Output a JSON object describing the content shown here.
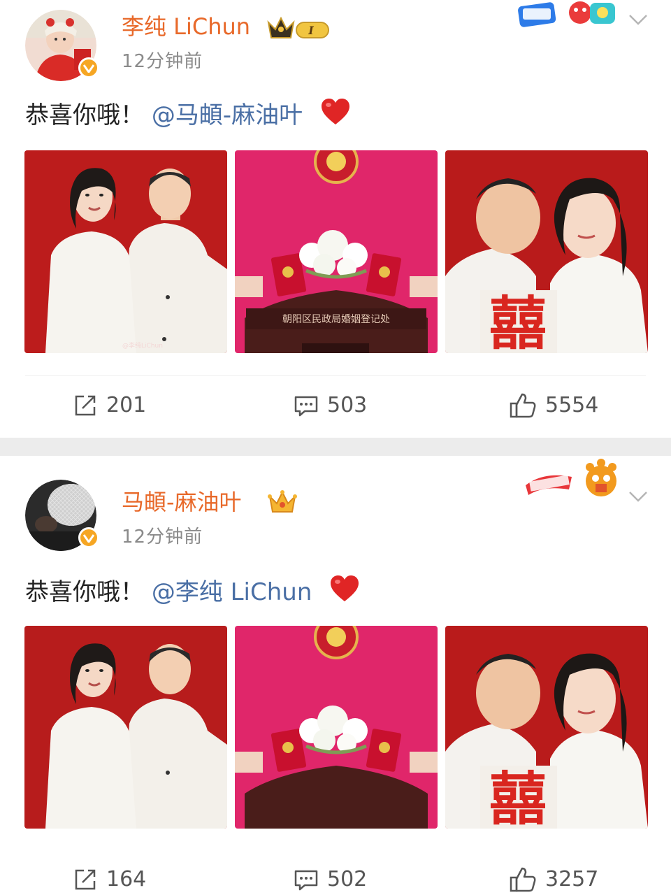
{
  "posts": [
    {
      "user": "李纯 LiChun",
      "time": "12分钟前",
      "text_prefix": "恭喜你哦！",
      "mention": "@马頔-麻油叶",
      "crown_badge": "I",
      "watermark": "@李纯LiChun",
      "plaque": "朝阳区民政局婚姻登记处",
      "stats": {
        "repost": "201",
        "comment": "503",
        "like": "5554"
      }
    },
    {
      "user": "马頔-麻油叶",
      "time": "12分钟前",
      "text_prefix": "恭喜你哦！",
      "mention": "@李纯 LiChun",
      "stats": {
        "repost": "164",
        "comment": "502",
        "like": "3257"
      }
    }
  ],
  "icons": {
    "repost": "repost-icon",
    "comment": "comment-icon",
    "like": "thumbs-up-icon",
    "more": "chevron-down-icon",
    "verified": "verified-badge-icon",
    "heart": "red-heart-icon"
  },
  "colors": {
    "username": "#e8692a",
    "mention": "#4a6fa5",
    "heart": "#e02525",
    "verified": "#f6a623",
    "photo_red": "#b71c1c",
    "photo_pink": "#e0266a"
  }
}
